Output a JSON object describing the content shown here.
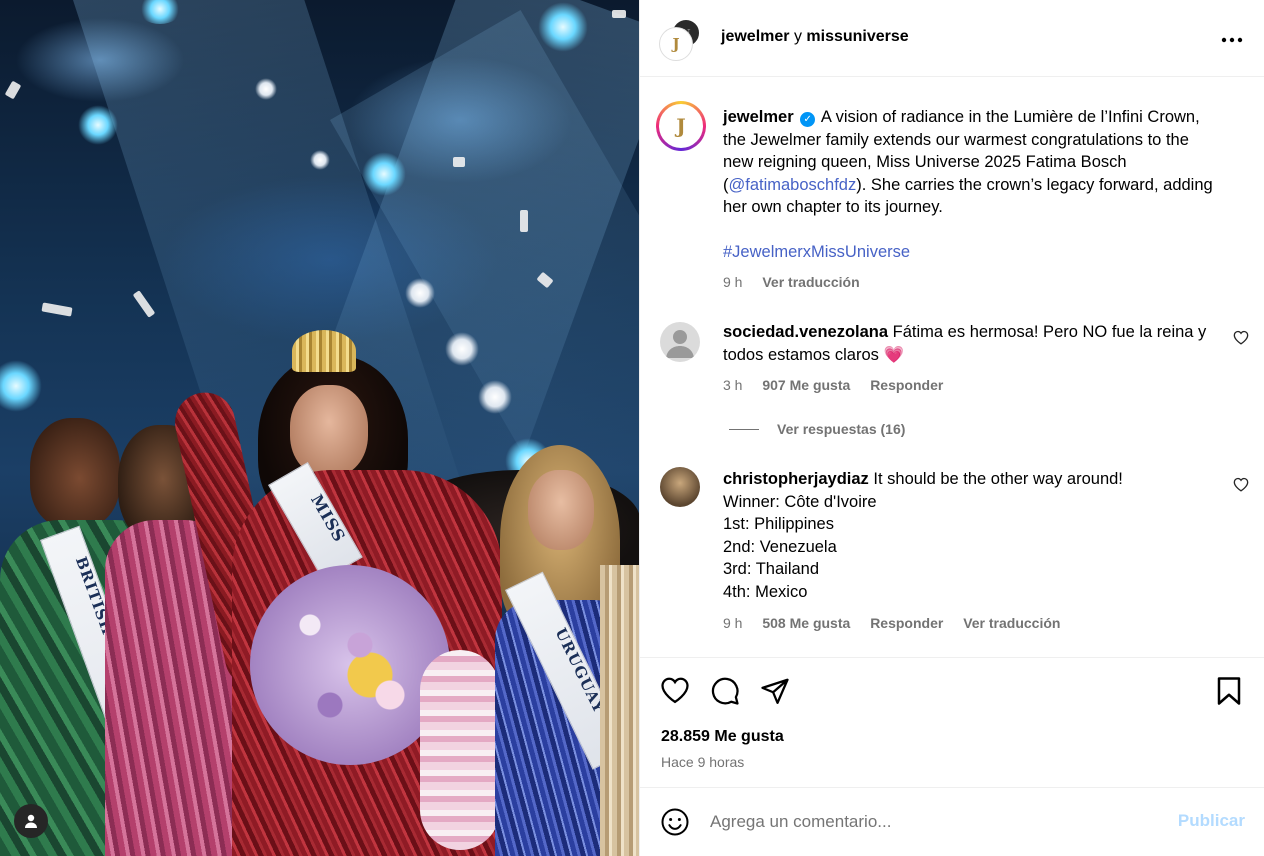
{
  "header": {
    "user1": "jewelmer",
    "connector": "y",
    "user2": "missuniverse"
  },
  "caption": {
    "username": "jewelmer",
    "text_before_mention": "A vision of radiance in the Lumière de l’Infini Crown, the Jewelmer family extends our warmest congratulations to the new reigning queen, Miss Universe 2025 Fatima Bosch (",
    "mention": "@fatimaboschfdz",
    "text_after_mention": "). She carries the crown’s legacy forward, adding her own chapter to its journey.",
    "hashtag": "#JewelmerxMissUniverse",
    "time": "9 h",
    "translate": "Ver traducción"
  },
  "comments": [
    {
      "username": "sociedad.venezolana",
      "text": "Fátima es hermosa! Pero NO fue la reina y todos estamos claros",
      "emoji": "💗",
      "time": "3 h",
      "likes": "907 Me gusta",
      "reply": "Responder",
      "view_replies": "Ver respuestas (16)"
    },
    {
      "username": "christopherjaydiaz",
      "lines": [
        "It should be the other way around!",
        "Winner: Côte d'Ivoire",
        "1st: Philippines",
        "2nd: Venezuela",
        "3rd: Thailand",
        "4th: Mexico"
      ],
      "time": "9 h",
      "likes": "508 Me gusta",
      "reply": "Responder",
      "translate": "Ver traducción"
    }
  ],
  "post": {
    "likes": "28.859 Me gusta",
    "time_ago": "Hace 9 horas"
  },
  "composer": {
    "placeholder": "Agrega un comentario...",
    "publish": "Publicar"
  },
  "photo": {
    "sash_left": "BRITISH VIRGIN ISLANDS",
    "sash_center": "MISS",
    "sash_right": "URUGUAY"
  },
  "icons": {
    "like": "heart-icon",
    "comment": "comment-icon",
    "share": "share-icon",
    "save": "bookmark-icon",
    "more": "more-icon",
    "emoji": "emoji-icon"
  },
  "colors": {
    "link": "#4762c6",
    "verified": "#0095f6",
    "publish_disabled": "#b3dbff",
    "secondary_text": "#737373"
  }
}
